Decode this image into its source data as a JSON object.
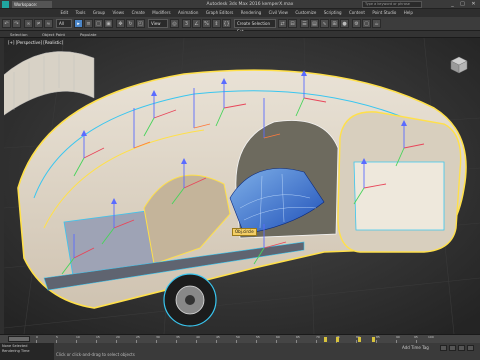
{
  "app": {
    "workspace": "Workspace: Default",
    "title": "Autodesk 3ds Max 2016    kemperX.max",
    "search_placeholder": "Type a keyword or phrase"
  },
  "window_controls": [
    "_",
    "□",
    "✕"
  ],
  "menu": [
    "Edit",
    "Tools",
    "Group",
    "Views",
    "Create",
    "Modifiers",
    "Animation",
    "Graph Editors",
    "Rendering",
    "Civil View",
    "Customize",
    "Scripting",
    "Content",
    "Point Studio",
    "Help"
  ],
  "toolbar": {
    "selection_filter": "All",
    "view_dropdown": "View",
    "named_selection": "Create Selection Set"
  },
  "ribbon": {
    "tabs": [
      "Selection",
      "Object Paint",
      "Populate"
    ]
  },
  "viewport": {
    "label": "[+] [Perspective] [Realistic]",
    "selected_object_label": "Obj.circle"
  },
  "timeline": {
    "frame_labels": [
      "0",
      "5",
      "10",
      "15",
      "20",
      "25",
      "30",
      "35",
      "40",
      "45",
      "50",
      "55",
      "60",
      "65",
      "70",
      "75",
      "80",
      "85",
      "90",
      "95",
      "100"
    ]
  },
  "statusbar": {
    "maxscript_lines": [
      "None Selected",
      "Rendering Time"
    ],
    "prompt": "Click or click-and-drag to select objects",
    "add_time_tag": "Add Time Tag"
  },
  "colors": {
    "accent_blue": "#4b86c9",
    "selection_yellow": "#f4cf66",
    "key_yellow": "#d8c33c",
    "viewport_bg": "#2a2a2a"
  }
}
